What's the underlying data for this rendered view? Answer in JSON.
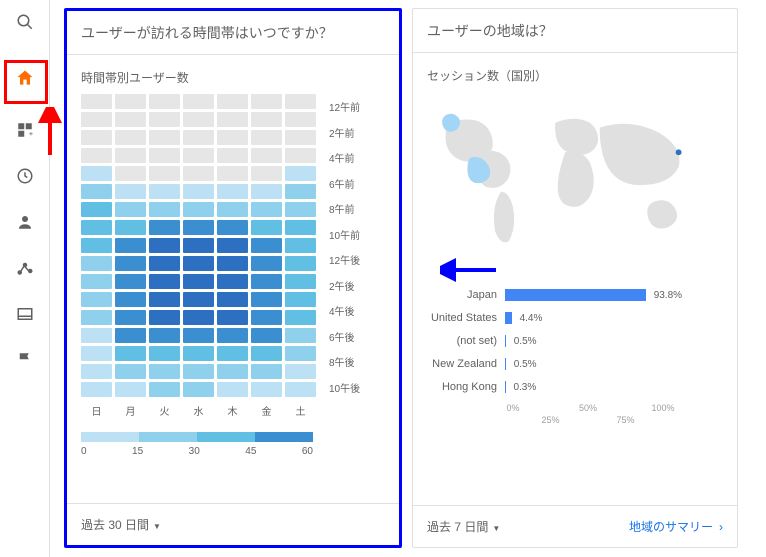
{
  "sidebar": {
    "items": [
      "search",
      "home",
      "customize",
      "clock",
      "user",
      "graph",
      "panel",
      "flag"
    ]
  },
  "left_card": {
    "title": "ユーザーが訪れる時間帯はいつですか？",
    "subtitle": "時間帯別ユーザー数",
    "footer": "過去 30 日間"
  },
  "right_card": {
    "title": "ユーザーの地域は？",
    "subtitle": "セッション数（国別）",
    "footer": "過去 7 日間",
    "link": "地域のサマリー"
  },
  "chart_data": [
    {
      "type": "heatmap",
      "title": "時間帯別ユーザー数",
      "x_categories": [
        "日",
        "月",
        "火",
        "水",
        "木",
        "金",
        "土"
      ],
      "y_categories": [
        "12午前",
        "2午前",
        "4午前",
        "6午前",
        "8午前",
        "10午前",
        "12午後",
        "2午後",
        "4午後",
        "6午後",
        "8午後",
        "10午後"
      ],
      "legend_ticks": [
        0,
        15,
        30,
        45,
        60
      ],
      "legend_colors": [
        "#bce1f4",
        "#8fd0ec",
        "#62bfe4",
        "#3b8fd1",
        "#2d6fc1"
      ],
      "values_by_day": {
        "日": [
          6,
          6,
          6,
          6,
          6,
          10,
          15,
          24,
          30,
          30,
          26,
          26,
          22,
          20,
          16,
          16,
          16,
          14,
          14,
          14,
          10,
          8,
          8,
          8
        ],
        "月": [
          6,
          6,
          6,
          4,
          4,
          4,
          6,
          10,
          22,
          32,
          40,
          40,
          40,
          40,
          40,
          40,
          40,
          40,
          36,
          28,
          20,
          16,
          14,
          10
        ],
        "火": [
          6,
          6,
          4,
          4,
          4,
          4,
          6,
          12,
          24,
          40,
          50,
          50,
          50,
          50,
          50,
          50,
          50,
          48,
          42,
          34,
          26,
          20,
          16,
          12
        ],
        "水": [
          6,
          6,
          4,
          4,
          4,
          4,
          6,
          12,
          24,
          40,
          50,
          50,
          50,
          50,
          50,
          50,
          50,
          48,
          42,
          34,
          26,
          20,
          16,
          12
        ],
        "木": [
          6,
          6,
          4,
          4,
          4,
          4,
          6,
          12,
          24,
          38,
          48,
          48,
          48,
          48,
          48,
          48,
          48,
          46,
          40,
          32,
          24,
          18,
          14,
          10
        ],
        "金": [
          6,
          6,
          4,
          4,
          4,
          4,
          6,
          10,
          22,
          34,
          44,
          44,
          44,
          44,
          44,
          44,
          44,
          42,
          36,
          30,
          22,
          16,
          12,
          10
        ],
        "土": [
          6,
          6,
          6,
          6,
          6,
          8,
          12,
          18,
          24,
          28,
          30,
          30,
          30,
          28,
          26,
          26,
          26,
          24,
          20,
          18,
          14,
          12,
          10,
          8
        ]
      }
    },
    {
      "type": "bar",
      "title": "セッション数（国別）",
      "orientation": "horizontal",
      "categories": [
        "Japan",
        "United States",
        "(not set)",
        "New Zealand",
        "Hong Kong"
      ],
      "values": [
        93.8,
        4.4,
        0.5,
        0.5,
        0.3
      ],
      "unit": "%",
      "xlim": [
        0,
        100
      ],
      "xticks_top": [
        0,
        50,
        100
      ],
      "xticks_bottom": [
        25,
        75
      ]
    }
  ]
}
